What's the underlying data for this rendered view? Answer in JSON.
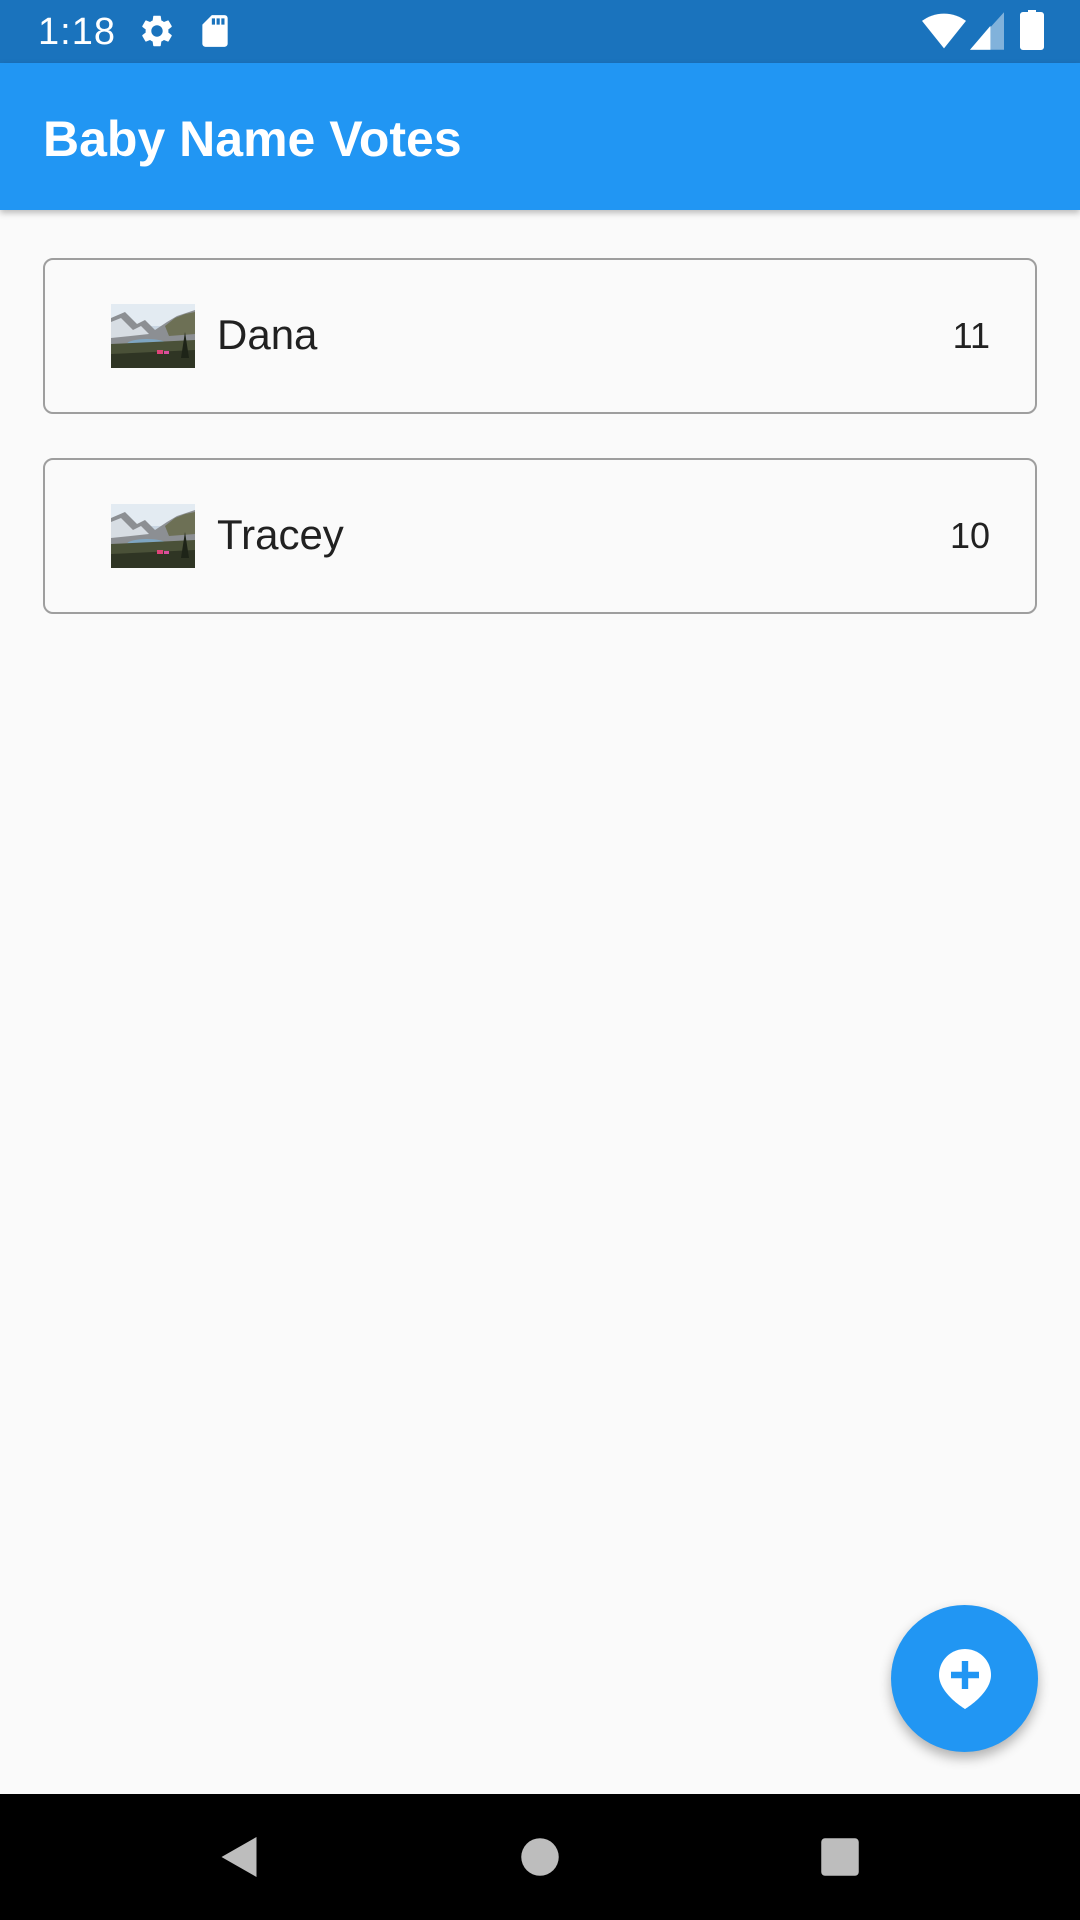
{
  "status_bar": {
    "time": "1:18",
    "icons": [
      "gear-icon",
      "sd-card-icon",
      "wifi-icon",
      "cell-signal-icon",
      "battery-icon"
    ]
  },
  "app_bar": {
    "title": "Baby Name Votes",
    "color": "#2196f3"
  },
  "names": [
    {
      "name": "Dana",
      "votes": "11",
      "thumbnail": "landscape-thumbnail"
    },
    {
      "name": "Tracey",
      "votes": "10",
      "thumbnail": "landscape-thumbnail"
    }
  ],
  "fab": {
    "icon": "add-location-icon",
    "color": "#2196f3"
  },
  "nav_bar": {
    "buttons": [
      "back-icon",
      "home-icon",
      "recents-icon"
    ]
  }
}
